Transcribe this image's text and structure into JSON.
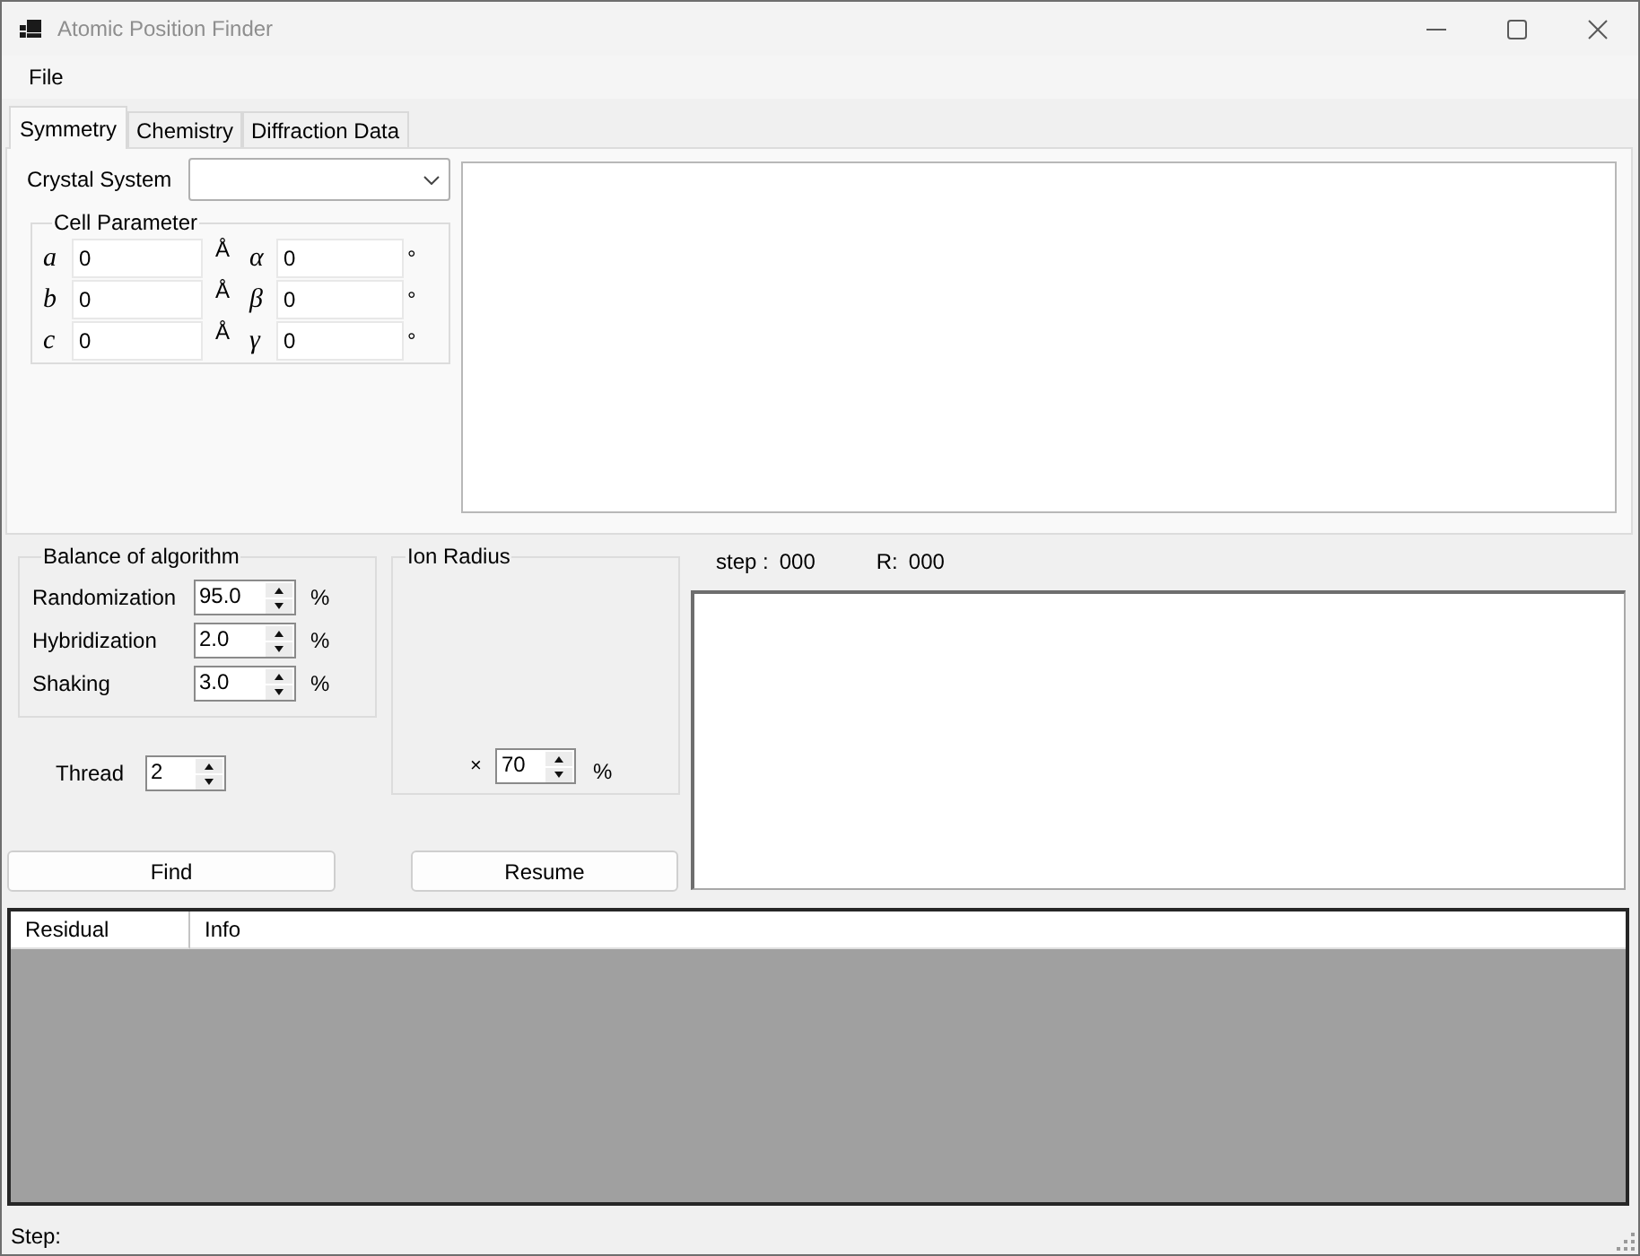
{
  "window": {
    "title": "Atomic Position Finder"
  },
  "menu": [
    "File"
  ],
  "tabs": [
    {
      "label": "Symmetry",
      "selected": true
    },
    {
      "label": "Chemistry",
      "selected": false
    },
    {
      "label": "Diffraction Data",
      "selected": false
    }
  ],
  "symmetry": {
    "crystal_system_label": "Crystal System",
    "cell_parameter": {
      "title": "Cell Parameter",
      "rows": [
        {
          "length_symbol": "a",
          "length_value": "0",
          "length_unit": "Å",
          "angle_symbol": "α",
          "angle_value": "0",
          "angle_unit": "°"
        },
        {
          "length_symbol": "b",
          "length_value": "0",
          "length_unit": "Å",
          "angle_symbol": "β",
          "angle_value": "0",
          "angle_unit": "°"
        },
        {
          "length_symbol": "c",
          "length_value": "0",
          "length_unit": "Å",
          "angle_symbol": "γ",
          "angle_value": "0",
          "angle_unit": "°"
        }
      ]
    }
  },
  "balance": {
    "title": "Balance of algorithm",
    "rows": [
      {
        "label": "Randomization",
        "value": "95.0",
        "unit": "%"
      },
      {
        "label": "Hybridization",
        "value": "2.0",
        "unit": "%"
      },
      {
        "label": "Shaking",
        "value": "3.0",
        "unit": "%"
      }
    ]
  },
  "thread": {
    "label": "Thread",
    "value": "2"
  },
  "ion_radius": {
    "title": "Ion Radius",
    "factor_sign": "×",
    "value": "70",
    "unit": "%"
  },
  "progress": {
    "step_label": "step :",
    "step_value": "000",
    "r_label": "R:",
    "r_value": "000"
  },
  "buttons": [
    {
      "label": "Find"
    },
    {
      "label": "Resume"
    }
  ],
  "results_table": {
    "columns": [
      "Residual",
      "Info"
    ]
  },
  "status_bar": {
    "text": "Step:"
  }
}
